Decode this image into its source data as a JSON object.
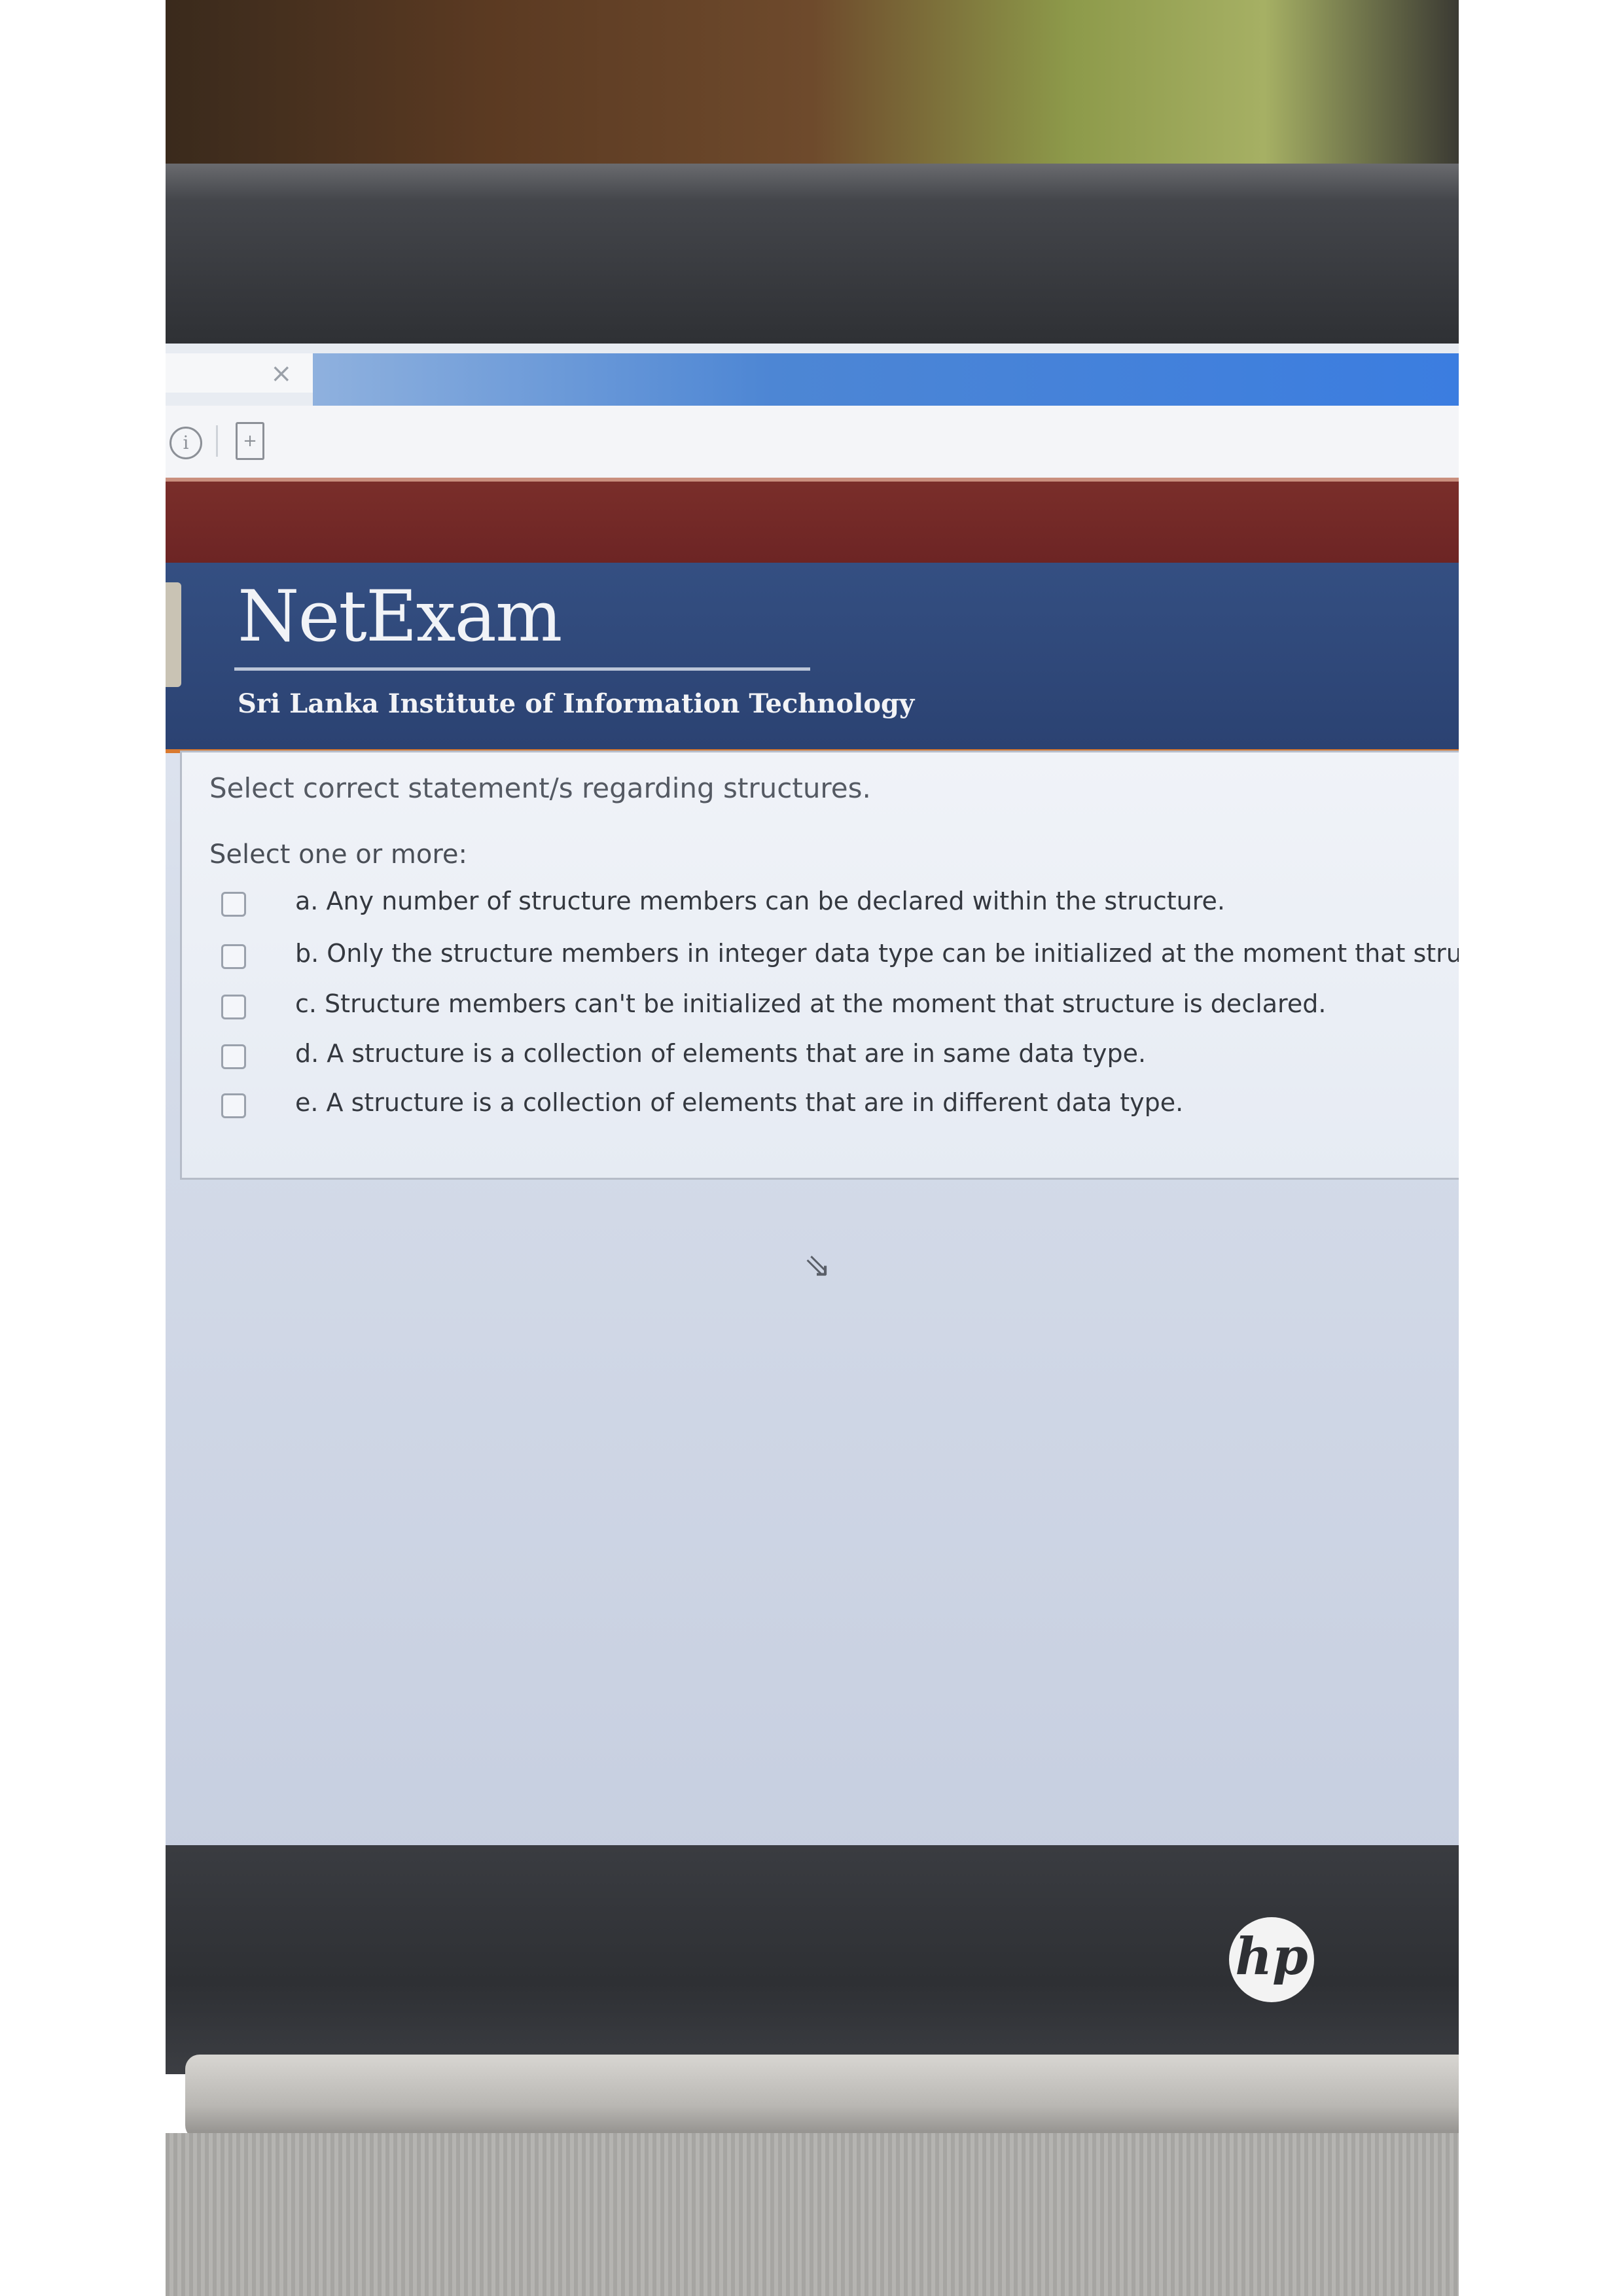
{
  "browser": {
    "tab_close_glyph": "×",
    "info_icon_glyph": "i"
  },
  "site": {
    "title": "NetExam",
    "subtitle": "Sri Lanka Institute of Information Technology"
  },
  "question": {
    "text": "Select correct statement/s regarding structures.",
    "prompt": "Select one or more:",
    "options": [
      {
        "label": "a. Any number of structure members can be declared within the structure.",
        "checked": false
      },
      {
        "label": "b. Only the structure members in integer data type can be initialized at the moment that structure is d",
        "checked": false
      },
      {
        "label": "c. Structure members can't be initialized at the moment that structure is declared.",
        "checked": false
      },
      {
        "label": "d. A structure is a collection of elements that are in  same data type.",
        "checked": false
      },
      {
        "label": "e. A structure is a collection of elements that are in  different data type.",
        "checked": false
      }
    ]
  },
  "laptop": {
    "brand_logo": "hp"
  },
  "colors": {
    "header_blue": "#2b4272",
    "header_accent_orange": "#d9792f",
    "maroon_band": "#6c2424"
  }
}
